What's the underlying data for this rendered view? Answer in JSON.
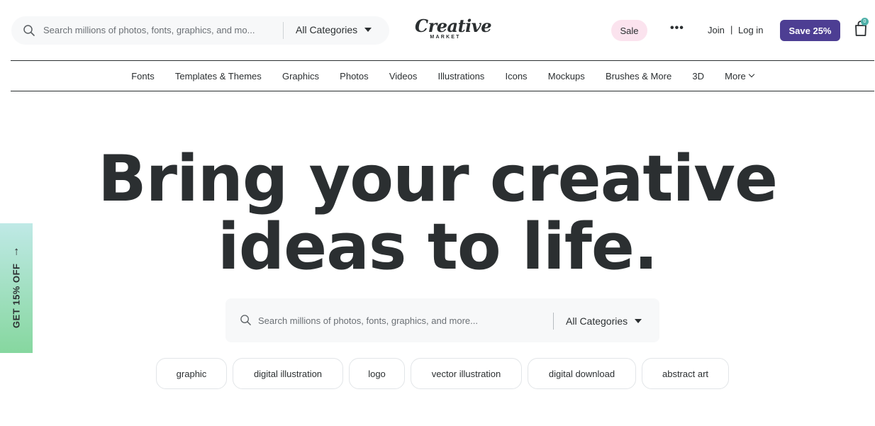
{
  "header": {
    "search": {
      "placeholder": "Search millions of photos, fonts, graphics, and mo...",
      "category": "All Categories"
    },
    "logo": {
      "title": "Creative",
      "subtitle": "MARKET"
    },
    "sale": "Sale",
    "more_menu": "•••",
    "join": "Join",
    "separator": "|",
    "login": "Log in",
    "save_button": "Save 25%",
    "cart_count": "0"
  },
  "nav": {
    "items": [
      "Fonts",
      "Templates & Themes",
      "Graphics",
      "Photos",
      "Videos",
      "Illustrations",
      "Icons",
      "Mockups",
      "Brushes & More",
      "3D",
      "More"
    ]
  },
  "hero": {
    "line1": "Bring your creative",
    "line2": "ideas to life.",
    "search": {
      "placeholder": "Search millions of photos, fonts, graphics, and more...",
      "category": "All Categories"
    },
    "tags": [
      "graphic",
      "digital illustration",
      "logo",
      "vector illustration",
      "digital download",
      "abstract art"
    ]
  },
  "promo": {
    "label": "GET 15% OFF",
    "arrow": "↑"
  },
  "colors": {
    "accent": "#4d3e93",
    "sale_bg": "#fbe3ee",
    "promo_top": "#bfe9e6",
    "promo_bottom": "#86d79f",
    "text": "#2b2f31"
  },
  "icons": [
    "search-icon",
    "caret-down-icon",
    "more-dots-icon",
    "cart-icon",
    "chevron-down-icon",
    "arrow-up-icon"
  ]
}
